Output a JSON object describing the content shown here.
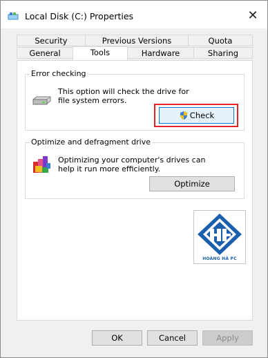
{
  "window": {
    "title": "Local Disk (C:) Properties"
  },
  "tabs": {
    "row1": [
      "Security",
      "Previous Versions",
      "Quota"
    ],
    "row2": [
      "General",
      "Tools",
      "Hardware",
      "Sharing"
    ],
    "active": "Tools"
  },
  "error_checking": {
    "group_label": "Error checking",
    "description": "This option will check the drive for file system errors.",
    "button_label": "Check",
    "icons": [
      "drive-icon",
      "uac-shield-icon"
    ]
  },
  "optimize": {
    "group_label": "Optimize and defragment drive",
    "description": "Optimizing your computer's drives can help it run more efficiently.",
    "button_label": "Optimize",
    "icons": [
      "defrag-icon"
    ]
  },
  "watermark": {
    "caption": "HOÀNG HÀ PC"
  },
  "footer": {
    "ok_label": "OK",
    "cancel_label": "Cancel",
    "apply_label": "Apply"
  },
  "colors": {
    "highlight": "#e8202a",
    "logo_blue": "#1a5fae",
    "check_button_border": "#0078d7"
  }
}
